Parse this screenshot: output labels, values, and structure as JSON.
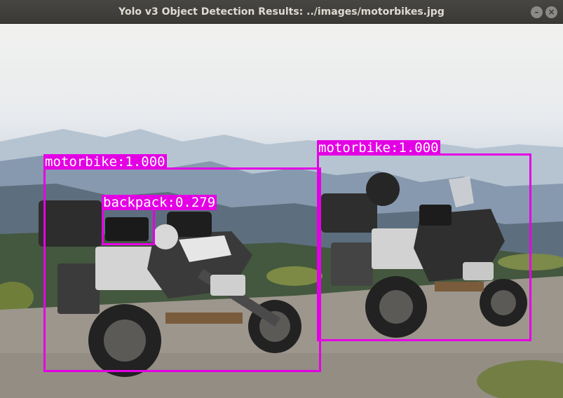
{
  "window": {
    "title": "Yolo v3 Object Detection Results: ../images/motorbikes.jpg",
    "controls": [
      {
        "name": "minimize",
        "icon": "minimize-icon",
        "glyph": "–"
      },
      {
        "name": "close",
        "icon": "close-icon",
        "glyph": "×"
      }
    ]
  },
  "detections": [
    {
      "label": "motorbike:1.000",
      "class": "motorbike",
      "confidence": 1.0,
      "color": "#e400e4"
    },
    {
      "label": "motorbike:1.000",
      "class": "motorbike",
      "confidence": 1.0,
      "color": "#e400e4"
    },
    {
      "label": "backpack:0.279",
      "class": "backpack",
      "confidence": 0.279,
      "color": "#e400e4"
    }
  ]
}
